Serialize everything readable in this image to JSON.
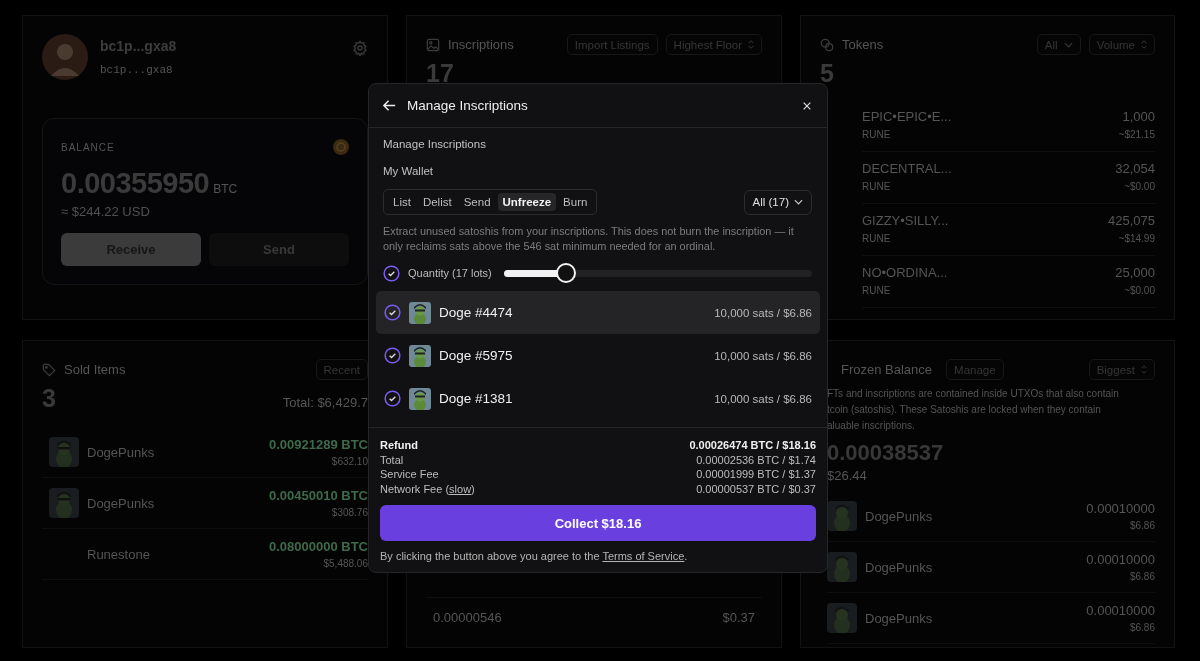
{
  "wallet": {
    "name": "bc1p...gxa8",
    "address": "bc1p...gxa8",
    "balance_label": "BALANCE",
    "balance": "0.00355950",
    "unit": "BTC",
    "usd": "≈ $244.22 USD",
    "buttons": [
      {
        "label": "Receive",
        "primary": true
      },
      {
        "label": "Send",
        "primary": false
      }
    ]
  },
  "inscriptions": {
    "title": "Inscriptions",
    "controls": [
      {
        "label": "Import Listings",
        "kind": "button"
      },
      {
        "label": "Highest Floor",
        "kind": "sort"
      }
    ],
    "count": "17",
    "rows": [
      {
        "value": "0.00000546",
        "usd": "$0.37"
      }
    ]
  },
  "tokens": {
    "title": "Tokens",
    "controls": [
      {
        "label": "All",
        "kind": "filter"
      },
      {
        "label": "Volume",
        "kind": "sort"
      }
    ],
    "count": "5",
    "rows": [
      {
        "name": "EPIC•EPIC•E...",
        "type": "RUNE",
        "amount": "1,000",
        "usd": "~$21.15"
      },
      {
        "name": "DECENTRAL...",
        "type": "RUNE",
        "amount": "32,054",
        "usd": "~$0.00"
      },
      {
        "name": "GIZZY•SILLY...",
        "type": "RUNE",
        "amount": "425,075",
        "usd": "~$14.99"
      },
      {
        "name": "NO•ORDINA...",
        "type": "RUNE",
        "amount": "25,000",
        "usd": "~$0.00"
      }
    ]
  },
  "sold": {
    "title": "Sold Items",
    "sort": "Recent",
    "count": "3",
    "total": "Total: $6,429.7",
    "rows": [
      {
        "name": "DogePunks",
        "thumbnail": true,
        "btc": "0.00921289 BTC",
        "usd": "$632.10"
      },
      {
        "name": "DogePunks",
        "thumbnail": true,
        "btc": "0.00450010 BTC",
        "usd": "$308.76"
      },
      {
        "name": "Runestone",
        "thumbnail": false,
        "btc": "0.08000000 BTC",
        "usd": "$5,488.06"
      }
    ]
  },
  "frozen": {
    "title": "Frozen Balance",
    "manage": "Manage",
    "sort": "Biggest",
    "description": [
      "FTs and inscriptions are contained inside UTXOs that also contain",
      "tcoin (satoshis). These Satoshis are locked when they contain",
      "aluable inscriptions."
    ],
    "amount": "0.00038537",
    "usd": "$26.44",
    "rows": [
      {
        "name": "DogePunks",
        "btc": "0.00010000",
        "usd": "$6.86"
      },
      {
        "name": "DogePunks",
        "btc": "0.00010000",
        "usd": "$6.86"
      },
      {
        "name": "DogePunks",
        "btc": "0.00010000",
        "usd": "$6.86"
      }
    ]
  },
  "modal": {
    "title": "Manage Inscriptions",
    "section": "Manage Inscriptions",
    "wallet_label": "My Wallet",
    "actions": [
      {
        "label": "List",
        "selected": false
      },
      {
        "label": "Delist",
        "selected": false
      },
      {
        "label": "Send",
        "selected": false
      },
      {
        "label": "Unfreeze",
        "selected": true
      },
      {
        "label": "Burn",
        "selected": false
      }
    ],
    "filter": "All (17)",
    "description": "Extract unused satoshis from your inscriptions. This does not burn the inscription — it only reclaims sats above the 546 sat minimum needed for an ordinal.",
    "quantity": {
      "label": "Quantity (17 lots)",
      "checked": true,
      "level": 0.2
    },
    "items": [
      {
        "name": "Doge #4474",
        "value": "10,000 sats / $6.86",
        "checked": true,
        "highlighted": true
      },
      {
        "name": "Doge #5975",
        "value": "10,000 sats / $6.86",
        "checked": true,
        "highlighted": false
      },
      {
        "name": "Doge #1381",
        "value": "10,000 sats / $6.86",
        "checked": true,
        "highlighted": false
      }
    ],
    "summary": [
      {
        "label": "Refund",
        "value": "0.00026474 BTC / $18.16",
        "bold": true
      },
      {
        "label": "Total",
        "value": "0.00002536 BTC / $1.74",
        "bold": false
      },
      {
        "label": "Service Fee",
        "value": "0.00001999 BTC / $1.37",
        "bold": false
      },
      {
        "label": "Network Fee (",
        "link": "slow",
        "label_end": ")",
        "value": "0.00000537 BTC / $0.37",
        "bold": false
      }
    ],
    "button": "Collect $18.16",
    "terms": {
      "text": "By clicking the button above you agree to the ",
      "link": "Terms of Service",
      "end": "."
    }
  }
}
